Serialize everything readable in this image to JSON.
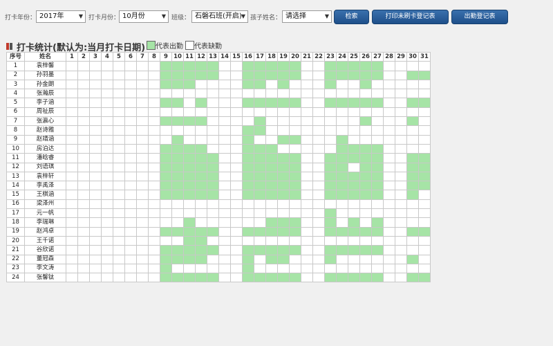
{
  "filters": {
    "year_label": "打卡年份：",
    "year_value": "2017年",
    "month_label": "打卡月份：",
    "month_value": "10月份",
    "class_label": "班级：",
    "class_value": "石磐石班(开启)",
    "child_label": "孩子姓名：",
    "child_value": "请选择"
  },
  "buttons": {
    "search": "检索",
    "print_unpunched": "打印未刷卡登记表",
    "attendance_sheet": "出勤登记表"
  },
  "section": {
    "title": "打卡统计(默认为:当月打卡日期)",
    "legend_present": "代表出勤",
    "legend_absent": "代表缺勤"
  },
  "colors": {
    "present": "#a6e4a6",
    "absent": "#ffffff",
    "button": "#2a5d99",
    "title_bar_red": "#c0392b",
    "title_bar_gray": "#555555"
  },
  "table": {
    "col_index": "序号",
    "col_name": "姓名",
    "days": [
      "1",
      "2",
      "3",
      "4",
      "5",
      "6",
      "7",
      "8",
      "9",
      "10",
      "11",
      "12",
      "13",
      "14",
      "15",
      "16",
      "17",
      "18",
      "19",
      "20",
      "21",
      "22",
      "23",
      "24",
      "25",
      "26",
      "27",
      "28",
      "29",
      "30",
      "31"
    ],
    "rows": [
      {
        "idx": "1",
        "name": "袁梓馨",
        "present": [
          9,
          10,
          11,
          12,
          13,
          16,
          17,
          18,
          19,
          20,
          23,
          24,
          25,
          26,
          27
        ]
      },
      {
        "idx": "2",
        "name": "孙羽墨",
        "present": [
          9,
          10,
          11,
          12,
          13,
          16,
          17,
          18,
          19,
          20,
          23,
          24,
          25,
          26,
          27,
          30,
          31
        ]
      },
      {
        "idx": "3",
        "name": "孙金朗",
        "present": [
          9,
          10,
          11,
          16,
          17,
          19,
          23,
          26
        ]
      },
      {
        "idx": "4",
        "name": "张瀚辰",
        "present": []
      },
      {
        "idx": "5",
        "name": "李子涵",
        "present": [
          9,
          10,
          12,
          16,
          17,
          18,
          19,
          20,
          23,
          24,
          25,
          26,
          27,
          30,
          31
        ]
      },
      {
        "idx": "6",
        "name": "周祉辰",
        "present": []
      },
      {
        "idx": "7",
        "name": "张瀛心",
        "present": [
          9,
          10,
          11,
          12,
          17,
          26,
          30
        ]
      },
      {
        "idx": "8",
        "name": "赵诗雅",
        "present": [
          16,
          17
        ]
      },
      {
        "idx": "9",
        "name": "赵靖涵",
        "present": [
          10,
          16,
          19,
          20,
          24
        ]
      },
      {
        "idx": "10",
        "name": "房泊达",
        "present": [
          9,
          10,
          11,
          12,
          16,
          17,
          18,
          24,
          25,
          26,
          27
        ]
      },
      {
        "idx": "11",
        "name": "潘晗睿",
        "present": [
          9,
          10,
          11,
          12,
          13,
          16,
          17,
          18,
          19,
          20,
          23,
          24,
          25,
          26,
          27,
          30,
          31
        ]
      },
      {
        "idx": "12",
        "name": "刘语琪",
        "present": [
          9,
          10,
          11,
          12,
          13,
          16,
          17,
          18,
          19,
          20,
          23,
          24,
          26,
          27,
          30,
          31
        ]
      },
      {
        "idx": "13",
        "name": "袁梓轩",
        "present": [
          9,
          10,
          11,
          12,
          13,
          16,
          17,
          18,
          19,
          20,
          23,
          24,
          25,
          26,
          27,
          30,
          31
        ]
      },
      {
        "idx": "14",
        "name": "李禹泽",
        "present": [
          9,
          10,
          11,
          12,
          13,
          16,
          17,
          18,
          19,
          20,
          23,
          24,
          25,
          26,
          27,
          30,
          31
        ]
      },
      {
        "idx": "15",
        "name": "王棋涵",
        "present": [
          9,
          10,
          11,
          12,
          13,
          16,
          17,
          18,
          19,
          20,
          23,
          24,
          25,
          26,
          27,
          30
        ]
      },
      {
        "idx": "16",
        "name": "梁泽州",
        "present": []
      },
      {
        "idx": "17",
        "name": "元一帆",
        "present": [
          23
        ]
      },
      {
        "idx": "18",
        "name": "李瑞琳",
        "present": [
          11,
          18,
          19,
          20,
          23,
          25,
          27
        ]
      },
      {
        "idx": "19",
        "name": "赵鸿卓",
        "present": [
          9,
          10,
          11,
          12,
          13,
          16,
          17,
          18,
          19,
          20,
          23,
          24,
          25,
          26,
          27,
          30,
          31
        ]
      },
      {
        "idx": "20",
        "name": "王千诺",
        "present": [
          11,
          12
        ]
      },
      {
        "idx": "21",
        "name": "谷欣诺",
        "present": [
          9,
          10,
          11,
          12,
          13,
          16,
          17,
          18,
          19,
          20,
          23,
          24,
          25,
          26,
          27
        ]
      },
      {
        "idx": "22",
        "name": "董冠森",
        "present": [
          9,
          10,
          11,
          12,
          16,
          18,
          19,
          23,
          30
        ]
      },
      {
        "idx": "23",
        "name": "李文涛",
        "present": [
          9,
          16
        ]
      },
      {
        "idx": "24",
        "name": "张馨钛",
        "present": [
          9,
          10,
          11,
          12,
          13,
          16,
          17,
          18,
          19,
          20,
          23,
          24,
          25,
          26,
          27,
          30,
          31
        ]
      }
    ]
  }
}
